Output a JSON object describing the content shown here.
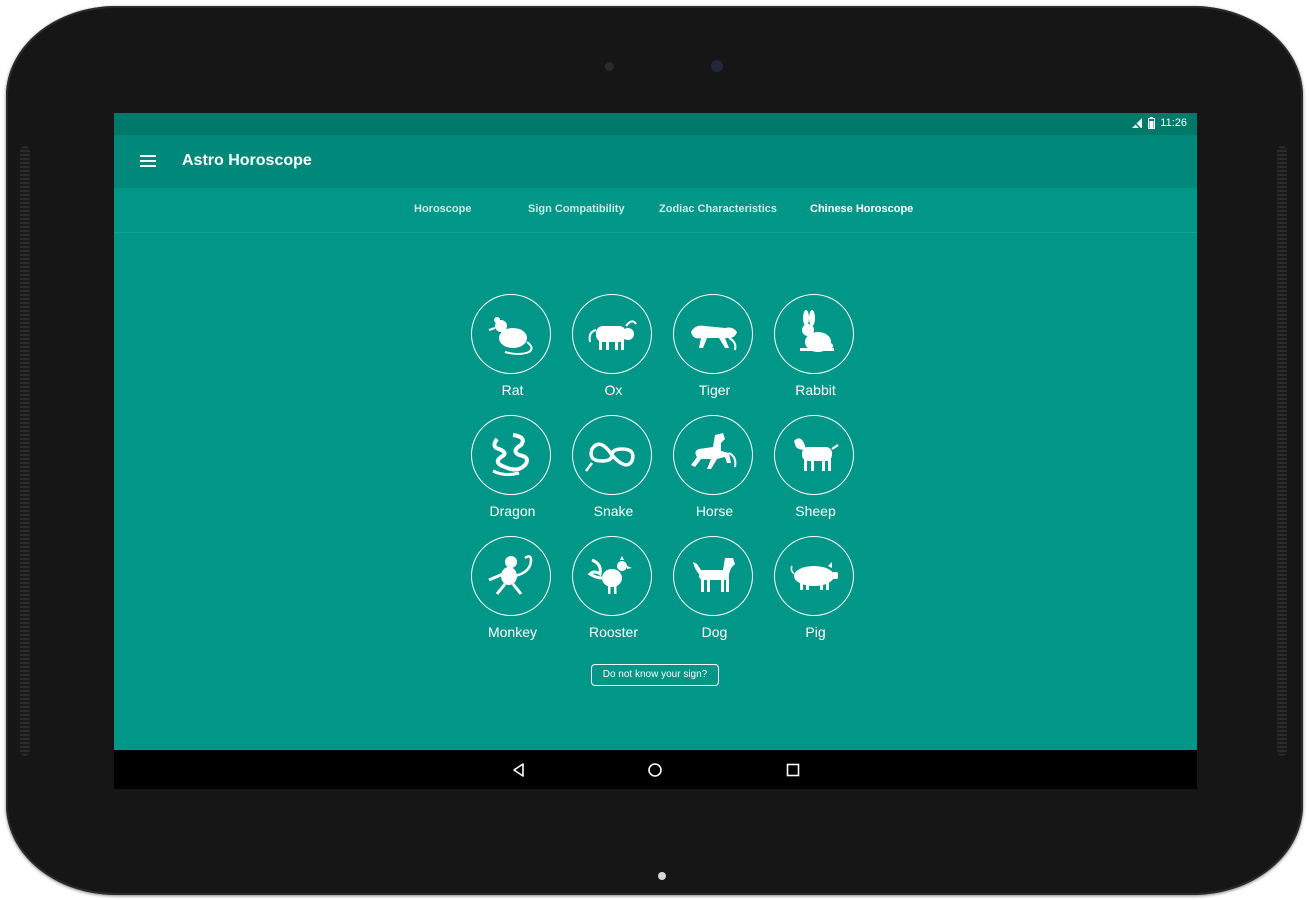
{
  "app": {
    "title": "Astro Horoscope",
    "theme_color": "#009688",
    "appbar_color": "#00897b",
    "statusbar_color": "#00796b"
  },
  "status": {
    "time": "11:26",
    "icons": [
      "signal-off-icon",
      "battery-icon"
    ]
  },
  "tabs": [
    {
      "label": "Horoscope",
      "active": false
    },
    {
      "label": "Sign Compatibility",
      "active": false
    },
    {
      "label": "Zodiac Characteristics",
      "active": false
    },
    {
      "label": "Chinese Horoscope",
      "active": true
    }
  ],
  "signs": [
    {
      "label": "Rat",
      "icon": "rat-icon"
    },
    {
      "label": "Ox",
      "icon": "ox-icon"
    },
    {
      "label": "Tiger",
      "icon": "tiger-icon"
    },
    {
      "label": "Rabbit",
      "icon": "rabbit-icon"
    },
    {
      "label": "Dragon",
      "icon": "dragon-icon"
    },
    {
      "label": "Snake",
      "icon": "snake-icon"
    },
    {
      "label": "Horse",
      "icon": "horse-icon"
    },
    {
      "label": "Sheep",
      "icon": "sheep-icon"
    },
    {
      "label": "Monkey",
      "icon": "monkey-icon"
    },
    {
      "label": "Rooster",
      "icon": "rooster-icon"
    },
    {
      "label": "Dog",
      "icon": "dog-icon"
    },
    {
      "label": "Pig",
      "icon": "pig-icon"
    }
  ],
  "unknown_sign_button": "Do not know your sign?",
  "navigation": {
    "icons": [
      "back-icon",
      "home-icon",
      "recents-icon"
    ]
  }
}
